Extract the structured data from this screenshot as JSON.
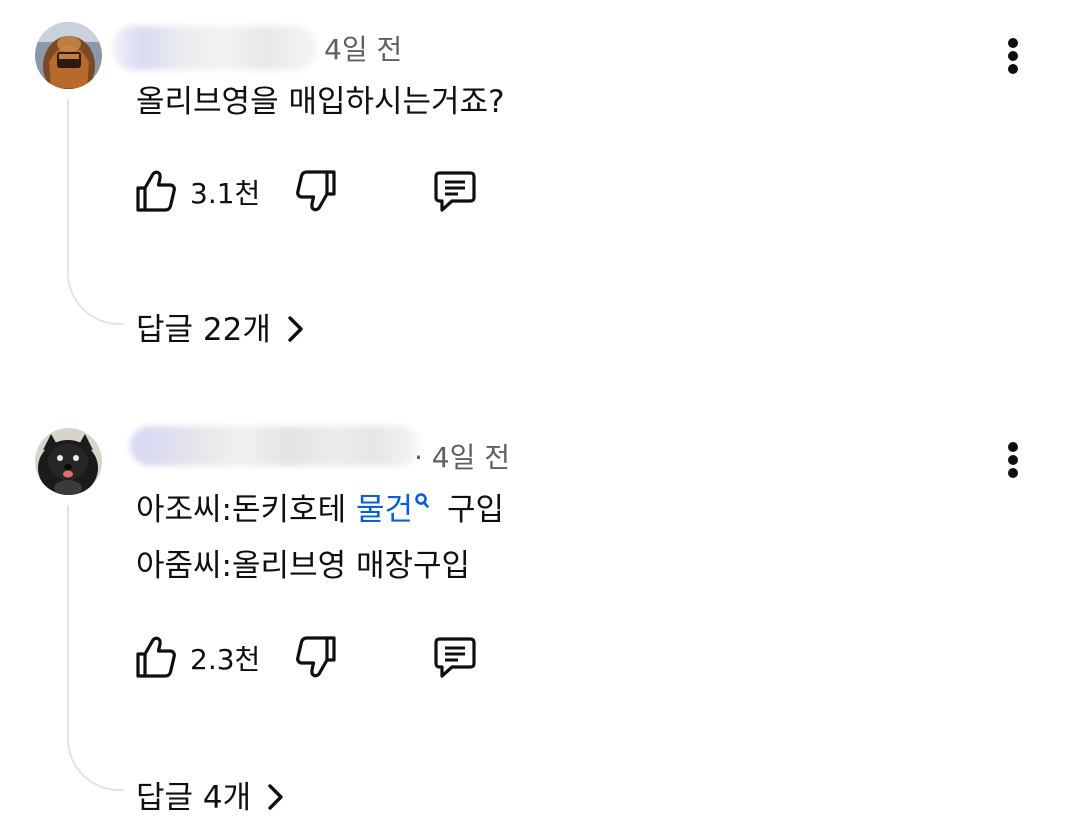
{
  "comments": [
    {
      "time": "4일 전",
      "lines": [
        "올리브영을 매입하시는거죠?"
      ],
      "likes": "3.1천",
      "replies": "답글 22개",
      "icons": {
        "more": "more-vert-icon",
        "like": "thumbs-up-icon",
        "dislike": "thumbs-down-icon",
        "reply": "comment-icon",
        "expand": "chevron-right-icon"
      }
    },
    {
      "time": "· 4일 전",
      "line1_pre": "아조씨:돈키호테 ",
      "line1_link": "물건",
      "line1_post": "구입",
      "line2": " 아줌씨:올리브영 매장구입",
      "likes": "2.3천",
      "replies": "답글 4개",
      "icons": {
        "more": "more-vert-icon",
        "like": "thumbs-up-icon",
        "dislike": "thumbs-down-icon",
        "reply": "comment-icon",
        "expand": "chevron-right-icon",
        "search": "search-icon"
      }
    }
  ],
  "colors": {
    "text": "#0f0f0f",
    "secondary": "#606060",
    "link": "#065fd4",
    "thread": "#e4e4e4"
  }
}
